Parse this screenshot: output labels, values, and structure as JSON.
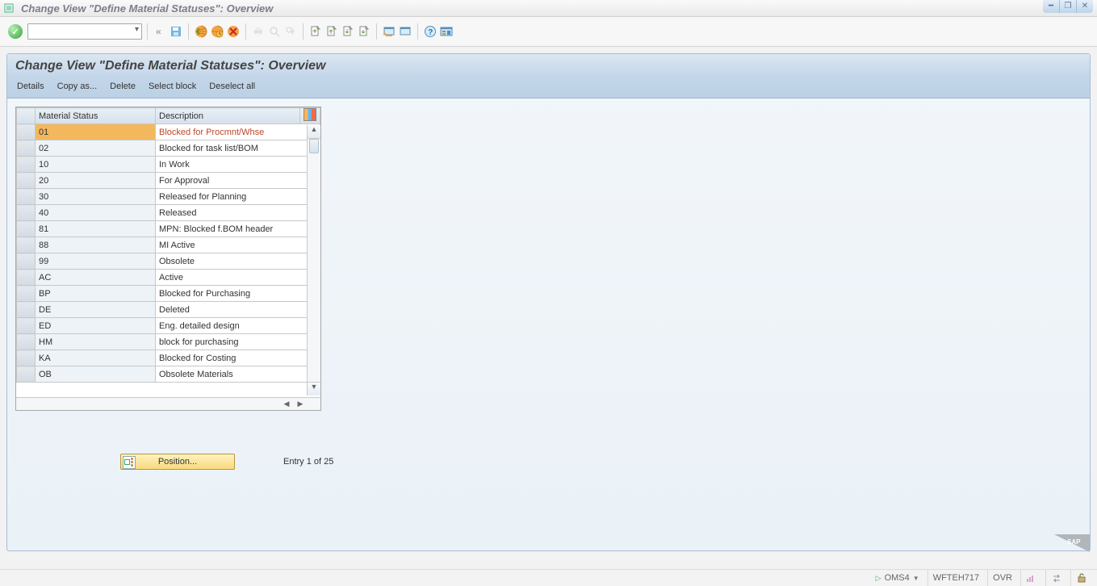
{
  "window": {
    "title": "Change View \"Define Material Statuses\": Overview"
  },
  "panel": {
    "title": "Change View \"Define Material Statuses\": Overview"
  },
  "actions": {
    "details": "Details",
    "copy_as": "Copy as...",
    "delete": "Delete",
    "select_block": "Select block",
    "deselect_all": "Deselect all"
  },
  "table": {
    "headers": {
      "status": "Material Status",
      "description": "Description"
    },
    "rows": [
      {
        "status": "01",
        "description": "Blocked for Procmnt/Whse",
        "selected": true
      },
      {
        "status": "02",
        "description": "Blocked for task list/BOM"
      },
      {
        "status": "10",
        "description": "In Work"
      },
      {
        "status": "20",
        "description": "For Approval"
      },
      {
        "status": "30",
        "description": "Released for Planning"
      },
      {
        "status": "40",
        "description": "Released"
      },
      {
        "status": "81",
        "description": "MPN: Blocked f.BOM header"
      },
      {
        "status": "88",
        "description": "MI Active"
      },
      {
        "status": "99",
        "description": "Obsolete"
      },
      {
        "status": "AC",
        "description": "Active"
      },
      {
        "status": "BP",
        "description": "Blocked for Purchasing"
      },
      {
        "status": "DE",
        "description": "Deleted"
      },
      {
        "status": "ED",
        "description": "Eng. detailed design"
      },
      {
        "status": "HM",
        "description": "block for purchasing"
      },
      {
        "status": "KA",
        "description": "Blocked for Costing"
      },
      {
        "status": "OB",
        "description": "Obsolete Materials"
      }
    ]
  },
  "position_button": "Position...",
  "entry_text": "Entry 1 of 25",
  "statusbar": {
    "tcode": "OMS4",
    "system": "WFTEH717",
    "mode": "OVR"
  }
}
